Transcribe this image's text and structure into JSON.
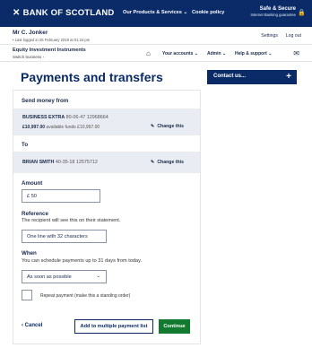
{
  "header": {
    "brand": "BANK OF SCOTLAND",
    "nav": [
      "Our Products & Services",
      "Cookie policy"
    ],
    "safe_title": "Safe & Secure",
    "safe_sub": "Internet Banking guarantee"
  },
  "user": {
    "name": "Mr C. Jonker",
    "last_logged": "Last logged in 25 February 2019 at 01:24 pm",
    "settings": "Settings",
    "logout": "Log out"
  },
  "subnav": {
    "product": "Equity Investment Instruments",
    "switch": "Switch business",
    "items": [
      "Your accounts",
      "Admin",
      "Help & support"
    ]
  },
  "page": {
    "title": "Payments and transfers",
    "contact": "Contact us..."
  },
  "form": {
    "send_from_label": "Send money from",
    "from_account": {
      "name": "BUSINESS EXTRA",
      "sort_acct": "80-06-47  12968664",
      "balance": "£10,997.00",
      "available": "available funds £10,997.00"
    },
    "change_label": "Change this",
    "to_label": "To",
    "to_account": {
      "name": "BRIAN SMITH",
      "sort_acct": "40-35-18  12575712"
    },
    "amount_label": "Amount",
    "amount_prefix": "£",
    "amount_value": "50",
    "reference_label": "Reference",
    "reference_hint": "The recipient will see this on their statement.",
    "reference_value": "One line with 32 characters",
    "when_label": "When",
    "when_hint": "You can schedule payments up to 31 days from today.",
    "when_value": "As soon as possible",
    "repeat_label": "Repeat payment (make this a standing order)",
    "cancel": "Cancel",
    "add_multiple": "Add to multiple payment list",
    "continue": "Continue"
  }
}
